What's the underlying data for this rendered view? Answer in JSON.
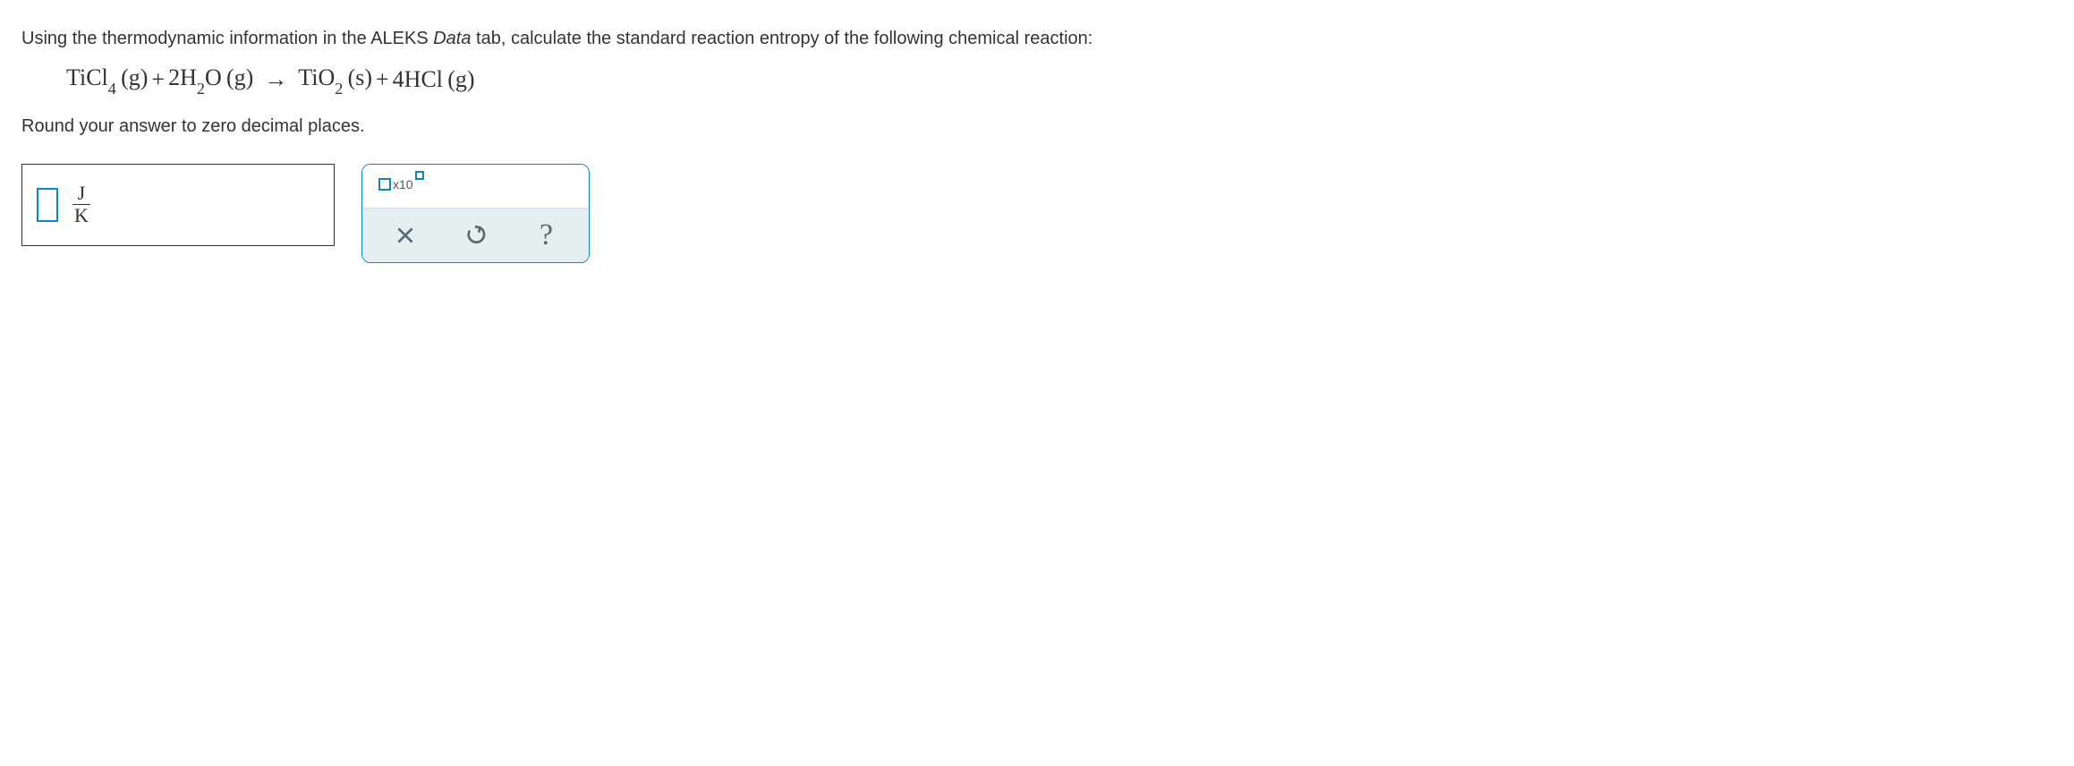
{
  "question": {
    "prefix": "Using the thermodynamic information in the ALEKS ",
    "data_tab": "Data",
    "suffix": " tab, calculate the standard reaction entropy of the following chemical reaction:"
  },
  "equation": {
    "r1_species": "TiCl",
    "r1_sub": "4",
    "r1_phase": "(g)",
    "plus1": "+",
    "r2_coef": "2",
    "r2_species": "H",
    "r2_sub": "2",
    "r2_species2": "O",
    "r2_phase": "(g)",
    "arrow": "→",
    "p1_species": "TiO",
    "p1_sub": "2",
    "p1_phase": "(s)",
    "plus2": "+",
    "p2_coef": "4",
    "p2_species": "HCl",
    "p2_phase": "(g)"
  },
  "instruction": "Round your answer to zero decimal places.",
  "units": {
    "numerator": "J",
    "denominator": "K"
  },
  "toolbar": {
    "sci_label_x10": "x10"
  }
}
